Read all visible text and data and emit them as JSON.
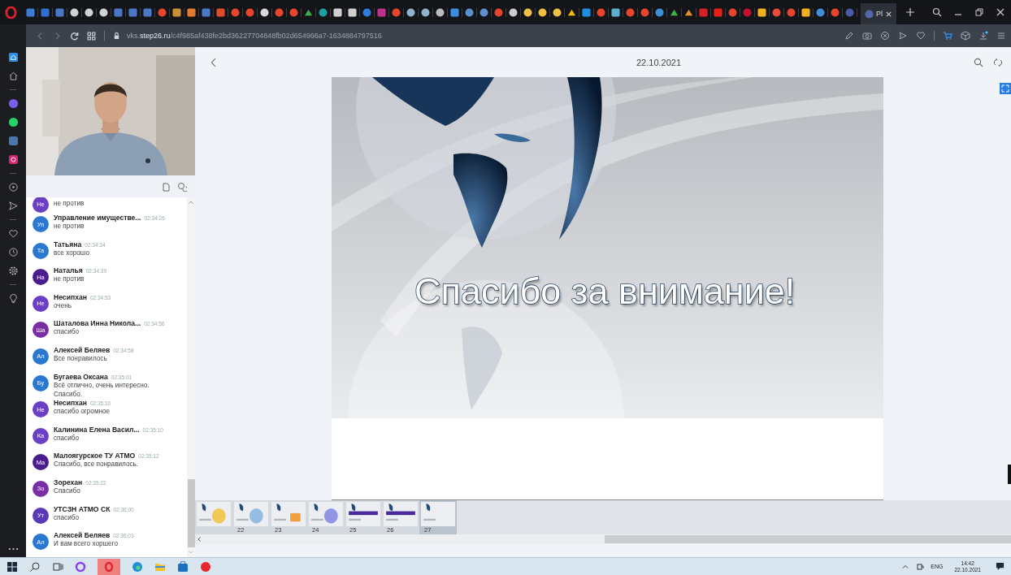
{
  "browser": {
    "url": "vks.**step26.ru**/c4f985af438fe2bd36227704848fb02d654966a7-1634884797516",
    "active_tab": {
      "title": "Pl"
    }
  },
  "chat": {
    "messages": [
      {
        "initials": "Не",
        "color": "#6b3fc4",
        "text": "не против"
      },
      {
        "initials": "Уп",
        "color": "#2b78d0",
        "name": "Управление имуществе...",
        "time": "02:34:26",
        "text": "не против"
      },
      {
        "initials": "Та",
        "color": "#2b78d0",
        "name": "Татьяна",
        "time": "02:34:34",
        "text": "все хорошо"
      },
      {
        "initials": "На",
        "color": "#4a1c8e",
        "name": "Наталья",
        "time": "02:34:39",
        "text": "не против"
      },
      {
        "initials": "Не",
        "color": "#6b3fc4",
        "name": "Несипхан",
        "time": "02:34:53",
        "text": "очень"
      },
      {
        "initials": "Ша",
        "color": "#7a2ea6",
        "name": "Шаталова Инна Никола...",
        "time": "02:34:56",
        "text": "спасибо"
      },
      {
        "initials": "Ал",
        "color": "#2b78d0",
        "name": "Алексей Беляев",
        "time": "02:34:58",
        "text": "Все понравилось"
      },
      {
        "initials": "Бу",
        "color": "#2b78d0",
        "name": "Бугаева Оксана",
        "time": "02:35:01",
        "text": "Всё отлично, очень интересно. Спасибо."
      },
      {
        "initials": "Не",
        "color": "#6b3fc4",
        "name": "Несипхан",
        "time": "02:35:10",
        "text": "спасибо огромное"
      },
      {
        "initials": "Ка",
        "color": "#6b3fc4",
        "name": "Калинина Елена Васил...",
        "time": "02:35:10",
        "text": "спасибо"
      },
      {
        "initials": "Ма",
        "color": "#4a1c8e",
        "name": "Малоягурское ТУ АТМО",
        "time": "02:35:12",
        "text": "Спасибо, все понравилось."
      },
      {
        "initials": "Зо",
        "color": "#7a2ea6",
        "name": "Зорехан",
        "time": "02:35:22",
        "text": "Спасибо"
      },
      {
        "initials": "Ут",
        "color": "#5b3ab8",
        "name": "УТСЗН АТМО СК",
        "time": "02:36:00",
        "text": "спасибо"
      },
      {
        "initials": "Ал",
        "color": "#2b78d0",
        "name": "Алексей Беляев",
        "time": "02:36:03",
        "text": "И вам всего хоршего"
      }
    ]
  },
  "viewer": {
    "date": "22.10.2021",
    "slide": {
      "title": "Спасибо за внимание!"
    },
    "thumbnails": [
      {
        "selected": false
      },
      {
        "number": "22",
        "selected": false
      },
      {
        "number": "23",
        "selected": false
      },
      {
        "number": "24",
        "selected": false
      },
      {
        "number": "25",
        "selected": false
      },
      {
        "number": "26",
        "selected": false
      },
      {
        "number": "27",
        "selected": true
      }
    ]
  },
  "taskbar": {
    "language": "ENG",
    "time": "14:42",
    "date": "22.10.2021"
  }
}
